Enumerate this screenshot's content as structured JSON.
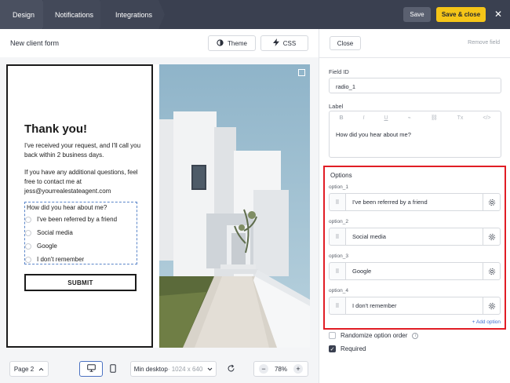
{
  "topbar": {
    "tabs": [
      {
        "label": "Design"
      },
      {
        "label": "Notifications"
      },
      {
        "label": "Integrations"
      }
    ],
    "save_label": "Save",
    "save_close_label": "Save & close",
    "close_symbol": "✕"
  },
  "editor": {
    "form_title": "New client form",
    "theme_label": "Theme",
    "css_label": "CSS",
    "icons": {
      "theme": "contrast-icon",
      "css": "lightning-icon"
    }
  },
  "preview": {
    "heading": "Thank you!",
    "message_1": "I've received your request, and I'll call you back within 2 business days.",
    "message_2": "If you have any additional questions, feel free to contact me at jess@yourrealestateagent.com",
    "question": "How did you hear about me?",
    "options": [
      {
        "label": "I've been referred by a friend"
      },
      {
        "label": "Social media"
      },
      {
        "label": "Google"
      },
      {
        "label": "I don't remember"
      }
    ],
    "submit_label": "SUBMIT"
  },
  "footer": {
    "page_label": "Page 2",
    "size_label": "Min desktop",
    "size_dims": "· 1024 x 640",
    "zoom_value": "78%",
    "zoom_minus": "−",
    "zoom_plus": "+"
  },
  "panel": {
    "close_label": "Close",
    "remove_label": "Remove field",
    "field_id_label": "Field ID",
    "field_id_value": "radio_1",
    "label_label": "Label",
    "rte_tools": [
      "B",
      "I",
      "U",
      "⌁",
      "⛓",
      "Tx",
      "</>"
    ],
    "label_value": "How did you hear about me?",
    "options_title": "Options",
    "options": [
      {
        "id": "option_1",
        "value": "I've been referred by a friend"
      },
      {
        "id": "option_2",
        "value": "Social media"
      },
      {
        "id": "option_3",
        "value": "Google"
      },
      {
        "id": "option_4",
        "value": "I don't remember"
      }
    ],
    "add_option_label": "+ Add option",
    "randomize_label": "Randomize option order",
    "required_label": "Required",
    "randomize_checked": false,
    "required_checked": true
  },
  "colors": {
    "topbar": "#3a4050",
    "accent_yellow": "#f5c518",
    "highlight_red": "#e11d25",
    "link_blue": "#3f6fd0"
  }
}
